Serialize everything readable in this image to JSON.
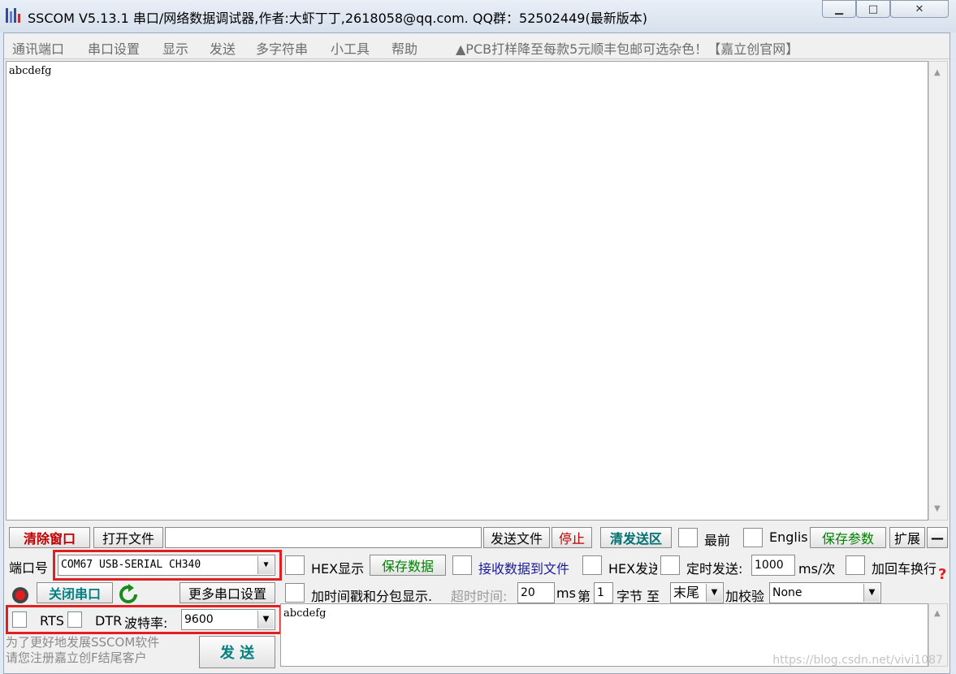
{
  "window": {
    "title": "SSCOM V5.13.1 串口/网络数据调试器,作者:大虾丁丁,2618058@qq.com. QQ群：52502449(最新版本)",
    "minimize_glyph": "▁",
    "maximize_glyph": "□",
    "close_glyph": "✕"
  },
  "menu": {
    "items": [
      "通讯端口",
      "串口设置",
      "显示",
      "发送",
      "多字符串",
      "小工具",
      "帮助"
    ],
    "ad": "▲PCB打样降至每款5元顺丰包邮可选杂色！【嘉立创官网】"
  },
  "receive": {
    "text": "abcdefg"
  },
  "toolbar": {
    "clear_window": "清除窗口",
    "open_file": "打开文件",
    "send_file": "发送文件",
    "stop": "停止",
    "clear_send": "清发送区",
    "topmost": "最前",
    "english": "Englis",
    "save_params": "保存参数",
    "expand": "扩展",
    "collapse": "—"
  },
  "port": {
    "port_label": "端口号",
    "port_value": "COM67 USB-SERIAL CH340",
    "close_port": "关闭串口",
    "more_settings": "更多串口设置",
    "rts": "RTS",
    "dtr": "DTR",
    "baud_label": "波特率:",
    "baud_value": "9600"
  },
  "options": {
    "hex_display": "HEX显示",
    "save_data": "保存数据",
    "recv_to_file": "接收数据到文件",
    "hex_send": "HEX发送",
    "timed_send": "定时发送:",
    "timed_interval": "1000",
    "timed_unit": "ms/次",
    "append_newline": "加回车换行",
    "timestamp": "加时间戳和分包显示.",
    "timeout_label": "超时时间:",
    "timeout_value": "20",
    "timeout_unit": "ms",
    "nth_label": "第",
    "nth_value": "1",
    "byte_to": "字节 至",
    "end_option": "末尾",
    "checksum_label": "加校验",
    "checksum_value": "None"
  },
  "send": {
    "text": "abcdefg",
    "button": "发 送",
    "promo": "为了更好地发展SSCOM软件\n请您注册嘉立创F结尾客户"
  },
  "watermark": "https://blog.csdn.net/vivi1087"
}
